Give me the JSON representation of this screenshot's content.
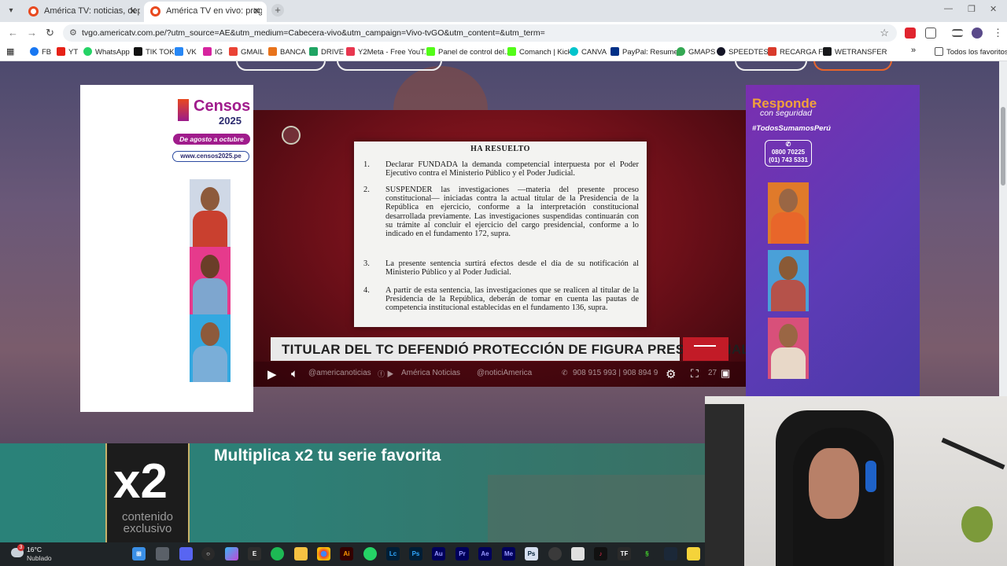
{
  "browser": {
    "tabs": [
      {
        "title": "América TV: noticias, deportes",
        "active": false
      },
      {
        "title": "América TV en vivo: programac",
        "active": true
      }
    ],
    "url": "tvgo.americatv.com.pe/?utm_source=AE&utm_medium=Cabecera-vivo&utm_campaign=Vivo-tvGO&utm_content=&utm_term=",
    "bookmarks": [
      {
        "label": "FB",
        "color": "#1877f2"
      },
      {
        "label": "YT",
        "color": "#e62117"
      },
      {
        "label": "WhatsApp",
        "color": "#25d366"
      },
      {
        "label": "TIK TOK",
        "color": "#111111"
      },
      {
        "label": "VK",
        "color": "#2787f5"
      },
      {
        "label": "IG",
        "color": "#d6249f"
      },
      {
        "label": "GMAIL",
        "color": "#ea4335"
      },
      {
        "label": "BANCA",
        "color": "#e8731b"
      },
      {
        "label": "DRIVE",
        "color": "#1fa463"
      },
      {
        "label": "Y2Meta - Free YouT...",
        "color": "#e8364f"
      },
      {
        "label": "Panel de control del...",
        "color": "#53fc18"
      },
      {
        "label": "Comanch | Kick",
        "color": "#53fc18"
      },
      {
        "label": "CANVA",
        "color": "#00c4cc"
      },
      {
        "label": "PayPal: Resumen",
        "color": "#003087"
      },
      {
        "label": "GMAPS",
        "color": "#34a853"
      },
      {
        "label": "SPEEDTEST",
        "color": "#141526"
      },
      {
        "label": "RECARGA FF",
        "color": "#d93a2b"
      },
      {
        "label": "WETRANSFER",
        "color": "#17181a"
      }
    ],
    "bookmarks_more": "»",
    "all_bookmarks": "Todos los favoritos"
  },
  "ad_left": {
    "brand": "Censos",
    "year": "2025",
    "dates": "De agosto a octubre",
    "url": "www.censos2025.pe"
  },
  "ad_right": {
    "title": "Responde",
    "subtitle": "con seguridad",
    "hashtag": "#TodosSumamosPerú",
    "phone1": "0800 70225",
    "phone2": "(01) 743 5331"
  },
  "player": {
    "document": {
      "heading": "HA RESUELTO",
      "items": [
        {
          "num": "1.",
          "text": "Declarar FUNDADA la demanda competencial interpuesta por el Poder Ejecutivo contra el Ministerio Público y el Poder Judicial."
        },
        {
          "num": "2.",
          "text": "SUSPENDER las investigaciones —materia del presente proceso constitucional— iniciadas contra la actual titular de la Presidencia de la República en ejercicio, conforme a la interpretación constitucional desarrollada previamente. Las investigaciones suspendidas continuarán con su trámite al concluir el ejercicio del cargo presidencial, conforme a lo indicado en el fundamento 172, supra."
        },
        {
          "num": "3.",
          "text": "La presente sentencia surtirá efectos desde el día de su notificación al Ministerio Público y al Poder Judicial."
        },
        {
          "num": "4.",
          "text": "A partir de esta sentencia, las investigaciones que se realicen al titular de la Presidencia de la República, deberán de tomar en cuenta las pautas de competencia institucional establecidas en el fundamento 136, supra."
        }
      ]
    },
    "headline": "TITULAR DEL TC DEFENDIÓ PROTECCIÓN DE FIGURA PRESIDENCIAL",
    "social": {
      "tiktok": "@americanoticias",
      "youtube": "América Noticias",
      "x": "@noticiAmerica",
      "whatsapp": "908 915 993  |  908 894 9",
      "time": "27"
    }
  },
  "banner": {
    "x2": "x2",
    "tag": "contenido exclusivo",
    "text": "Multiplica x2 tu serie favorita"
  },
  "taskbar": {
    "weather_temp": "16°C",
    "weather_desc": "Nublado",
    "weather_badge": "3",
    "apps": [
      "start",
      "search",
      "discord",
      "obs",
      "copilot",
      "epic",
      "spotify",
      "explorer",
      "chrome",
      "illustrator",
      "whatsapp",
      "lightroom",
      "photoshop",
      "audition",
      "premiere",
      "aftereffects",
      "mediaencoder",
      "ps-alt",
      "capcut",
      "screentool",
      "tiktok",
      "tf",
      "razer",
      "steam",
      "sticky"
    ]
  },
  "colors": {
    "accent_red": "#c21b27",
    "censos_purple": "#a01c8c",
    "responde_orange": "#f2a23a",
    "banner_teal": "#2a8279"
  }
}
